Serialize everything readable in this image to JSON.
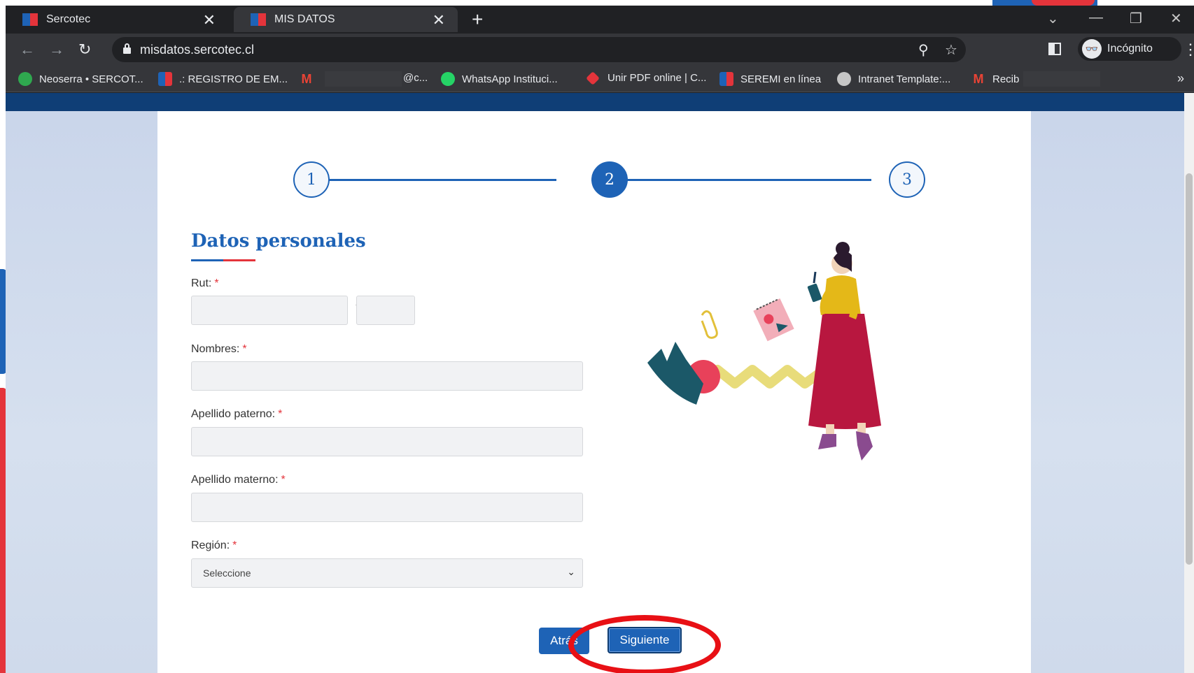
{
  "tabs": [
    {
      "title": "Sercotec",
      "active": false
    },
    {
      "title": "MIS DATOS",
      "active": true
    }
  ],
  "toolbar": {
    "url": "misdatos.sercotec.cl",
    "profile_label": "Incógnito"
  },
  "bookmarks": [
    {
      "label": "Neoserra • SERCOT...",
      "icon": "neoserra-icon"
    },
    {
      "label": ".: REGISTRO DE EM...",
      "icon": "chile-flag-icon"
    },
    {
      "label": "@c...",
      "icon": "gmail-icon"
    },
    {
      "label": "WhatsApp Instituci...",
      "icon": "whatsapp-icon"
    },
    {
      "label": "Unir PDF online | C...",
      "icon": "heart-icon"
    },
    {
      "label": "SEREMI en línea",
      "icon": "chile-flag-icon"
    },
    {
      "label": "Intranet Template:...",
      "icon": "globe-icon"
    },
    {
      "label": "Recib",
      "icon": "gmail-icon"
    }
  ],
  "stepper": {
    "steps": [
      "1",
      "2",
      "3"
    ],
    "current_step": "2"
  },
  "form": {
    "title": "Datos personales",
    "required_marker": "*",
    "rut_label": "Rut:",
    "rut_separator": "-",
    "nombres_label": "Nombres:",
    "apellido_paterno_label": "Apellido paterno:",
    "apellido_materno_label": "Apellido materno:",
    "region_label": "Región:",
    "region_selected": "Seleccione"
  },
  "buttons": {
    "back_label": "Atrás",
    "next_label": "Siguiente"
  },
  "colors": {
    "brand_blue": "#1e63b6",
    "brand_red": "#e4343b",
    "header_navy": "#0f3e76",
    "highlight_red": "#e81015"
  }
}
